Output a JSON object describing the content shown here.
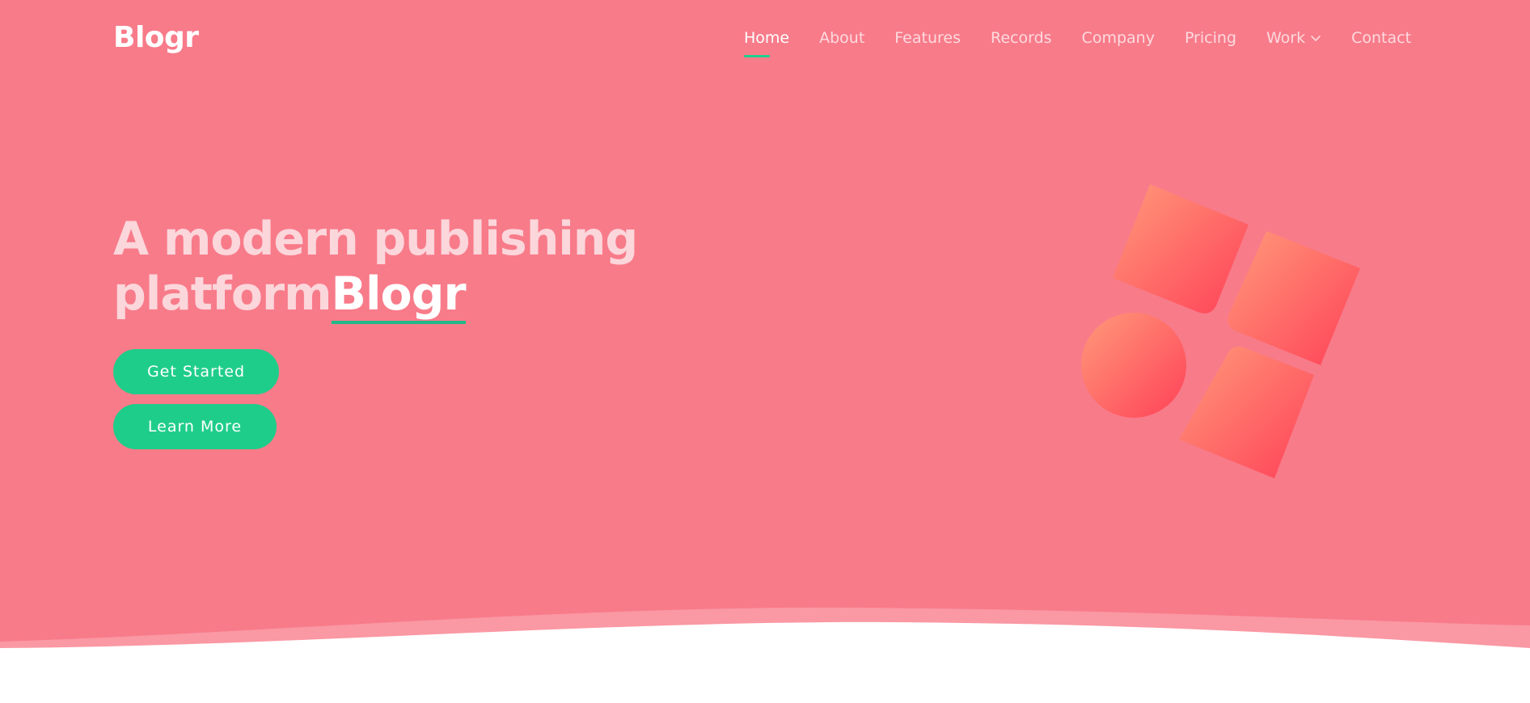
{
  "brand": {
    "name": "Blogr"
  },
  "nav": {
    "items": [
      {
        "label": "Home",
        "active": true
      },
      {
        "label": "About"
      },
      {
        "label": "Features"
      },
      {
        "label": "Records"
      },
      {
        "label": "Company"
      },
      {
        "label": "Pricing"
      },
      {
        "label": "Work",
        "has_dropdown": true
      },
      {
        "label": "Contact"
      }
    ],
    "dropdown_icon": "chevron-down-icon"
  },
  "hero": {
    "headline_line1": "A modern publishing",
    "headline_line2": "platform",
    "headline_accent": "Blogr",
    "buttons": {
      "primary": "Get Started",
      "secondary": "Learn More"
    },
    "illustration_icon": "shapes-illustration"
  },
  "colors": {
    "hero_background": "#f87b8a",
    "accent_green": "#1fcd8a",
    "headline_muted": "#fbd6db",
    "shape_gradient_start": "#ff9a7a",
    "shape_gradient_end": "#ff4158"
  }
}
